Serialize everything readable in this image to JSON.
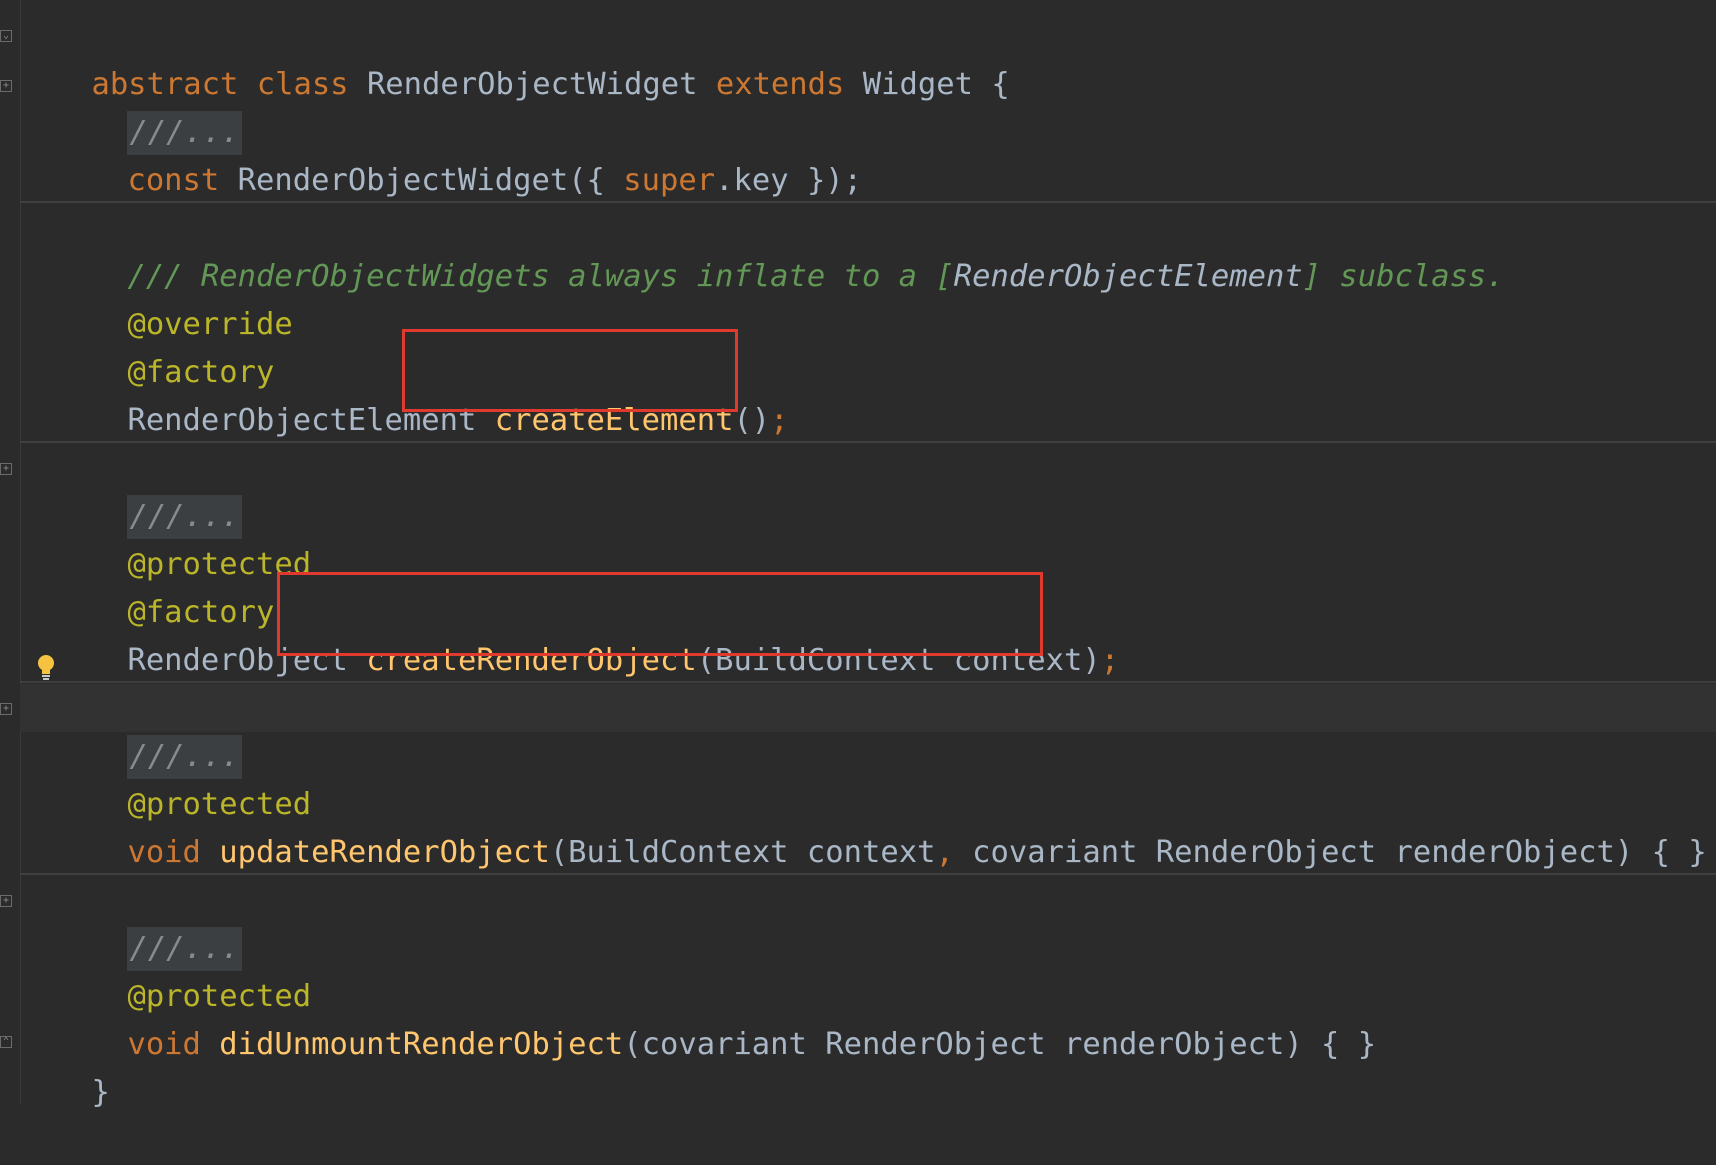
{
  "editor": {
    "colors": {
      "background": "#2b2b2b",
      "keyword": "#cc7832",
      "function": "#ffc66d",
      "annotation": "#bbb529",
      "doc_comment": "#629755",
      "highlight_box": "#e03a2e"
    },
    "lines": {
      "l1": {
        "kw1": "abstract",
        "kw2": "class",
        "name": "RenderObjectWidget",
        "kw3": "extends",
        "parent": "Widget",
        "brace": "{"
      },
      "l2": {
        "collapsed": "///..."
      },
      "l3": {
        "kw": "const",
        "name": "RenderObjectWidget({",
        "super": "super",
        "rest": ".key });",
        "semi": ";"
      },
      "l4": {
        "doc_start": "/// RenderObjectWidgets always inflate to a [",
        "doc_ref": "RenderObjectElement",
        "doc_end": "] subclass."
      },
      "l5": {
        "ann": "@override"
      },
      "l6": {
        "ann": "@factory"
      },
      "l7": {
        "type": "RenderObjectElement",
        "fn": "createElement",
        "args": "()",
        "semi": ";"
      },
      "l8": {
        "collapsed": "///..."
      },
      "l9": {
        "ann": "@protected"
      },
      "l10": {
        "ann": "@factory"
      },
      "l11": {
        "type": "RenderObject",
        "fn": "createRenderObject",
        "args": "(BuildContext context)",
        "semi": ";"
      },
      "l12": {
        "collapsed": "///..."
      },
      "l13": {
        "ann": "@protected"
      },
      "l14": {
        "kw": "void",
        "fn": "updateRenderObject",
        "args1": "(BuildContext context",
        "comma": ",",
        "args2": " covariant RenderObject renderObject) { }"
      },
      "l15": {
        "collapsed": "///..."
      },
      "l16": {
        "ann": "@protected"
      },
      "l17": {
        "kw": "void",
        "fn": "didUnmountRenderObject",
        "args": "(covariant RenderObject renderObject) { }"
      },
      "l18": {
        "brace": "}"
      }
    },
    "icons": {
      "bulb": "lightbulb-icon",
      "fold": "fold-toggle-icon"
    }
  }
}
